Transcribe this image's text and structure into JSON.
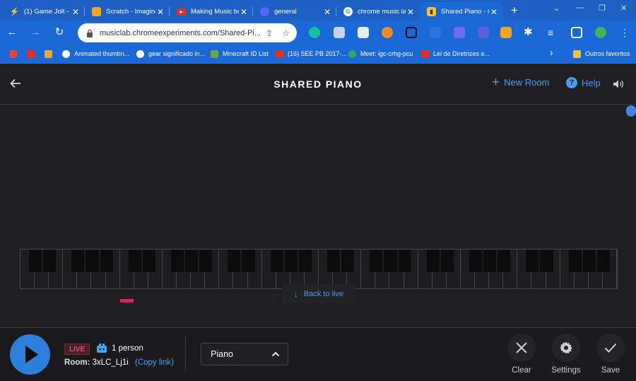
{
  "browser": {
    "tabs": [
      {
        "title": "(1) Game Jolt - G",
        "icon": "gamejolt-icon",
        "color": "#ffffff"
      },
      {
        "title": "Scratch - Imagine",
        "icon": "scratch-icon",
        "color": "#f5a623"
      },
      {
        "title": "Making Music bu",
        "icon": "youtube-icon",
        "color": "#e52d27"
      },
      {
        "title": "general",
        "icon": "discord-icon",
        "color": "#5865f2"
      },
      {
        "title": "chrome music lab",
        "icon": "google-icon",
        "color": "#ffffff"
      },
      {
        "title": "Shared Piano - C",
        "icon": "musiclab-icon",
        "color": "#f2c230",
        "active": true
      }
    ],
    "new_tab": "+",
    "window_controls": [
      "⌄",
      "—",
      "❐",
      "✕"
    ],
    "url": "musiclab.chromeexperiments.com/Shared-Pi...",
    "bookmarks": [
      {
        "label": "",
        "icon": "gmail-icon",
        "color": "#ea4335"
      },
      {
        "label": "",
        "icon": "youtube-icon",
        "color": "#e52d27"
      },
      {
        "label": "",
        "icon": "scratch-icon",
        "color": "#f5a623"
      },
      {
        "label": "Animated thumbn...",
        "icon": "animated-icon",
        "color": "#ffffff"
      },
      {
        "label": "gear significado in...",
        "icon": "google-icon",
        "color": "#ffffff"
      },
      {
        "label": "Minecraft ID List",
        "icon": "minecraft-icon",
        "color": "#6aa84f"
      },
      {
        "label": "(16) SEE PB 2017-...",
        "icon": "youtube-icon",
        "color": "#e52d27"
      },
      {
        "label": "Meet: igc-crhg-pcu",
        "icon": "meet-icon",
        "color": "#34a853"
      },
      {
        "label": "Lei de Diretrizes e...",
        "icon": "youtube-icon",
        "color": "#e52d27"
      }
    ],
    "more_bookmarks": "›",
    "other_bookmarks": "Outros favoritos"
  },
  "app": {
    "title": "SHARED PIANO",
    "new_room_label": "New Room",
    "help_label": "Help",
    "back_to_live": "Back to live",
    "live_badge": "LIVE",
    "person_count": "1 person",
    "room_label": "Room:",
    "room_code": "3xLC_Lj1i",
    "copy_link": "(Copy link)",
    "instrument": "Piano",
    "actions": {
      "clear": "Clear",
      "settings": "Settings",
      "save": "Save"
    },
    "accent_color": "#4a9df2",
    "live_color": "#e64b6f"
  }
}
